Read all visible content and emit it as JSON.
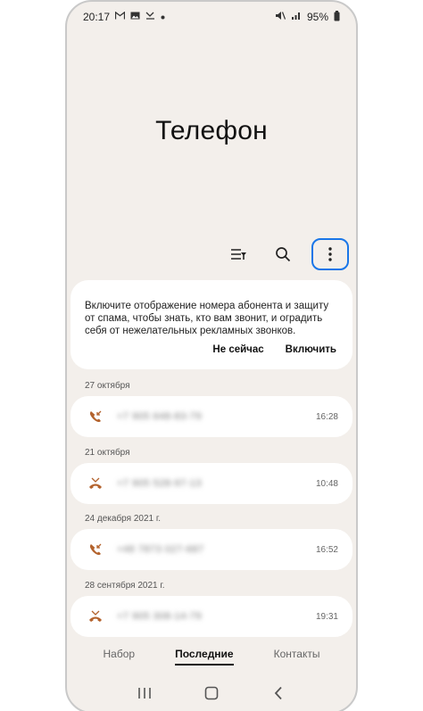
{
  "status": {
    "time": "20:17",
    "battery": "95%",
    "left_icons": [
      "gmail-icon",
      "gallery-icon",
      "missed-call-icon",
      "dot-icon"
    ],
    "right_icons": [
      "mute-icon",
      "signal-icon",
      "battery-icon"
    ]
  },
  "app": {
    "title": "Телефон"
  },
  "toolbar": {
    "icons": [
      "filter-icon",
      "search-icon",
      "more-options-icon"
    ],
    "highlight_color": "#1976e8"
  },
  "banner": {
    "text": "Включите отображение номера абонента и защиту от спама, чтобы знать, кто вам звонит, и оградить себя от нежелательных рекламных звонков.",
    "dismiss_label": "Не сейчас",
    "enable_label": "Включить"
  },
  "call_log": [
    {
      "date": "27 октября",
      "number": "+7 905 648-83-79",
      "time": "16:28",
      "type": "incoming",
      "icon": "incoming-call-icon"
    },
    {
      "date": "21 октября",
      "number": "+7 905 528-97-13",
      "time": "10:48",
      "type": "missed",
      "icon": "missed-call-icon"
    },
    {
      "date": "24 декабря 2021 г.",
      "number": "+48 7873 027-687",
      "time": "16:52",
      "type": "incoming",
      "icon": "incoming-call-icon"
    },
    {
      "date": "28 сентября 2021 г.",
      "number": "+7 905 308-14-79",
      "time": "19:31",
      "type": "missed",
      "icon": "missed-call-icon"
    }
  ],
  "colors": {
    "call_icon": "#b3622c",
    "background": "#f3efeb",
    "card": "#ffffff"
  },
  "tabs": [
    {
      "label": "Набор",
      "active": false
    },
    {
      "label": "Последние",
      "active": true
    },
    {
      "label": "Контакты",
      "active": false
    }
  ],
  "nav": [
    "recent-apps-icon",
    "home-icon",
    "back-icon"
  ]
}
